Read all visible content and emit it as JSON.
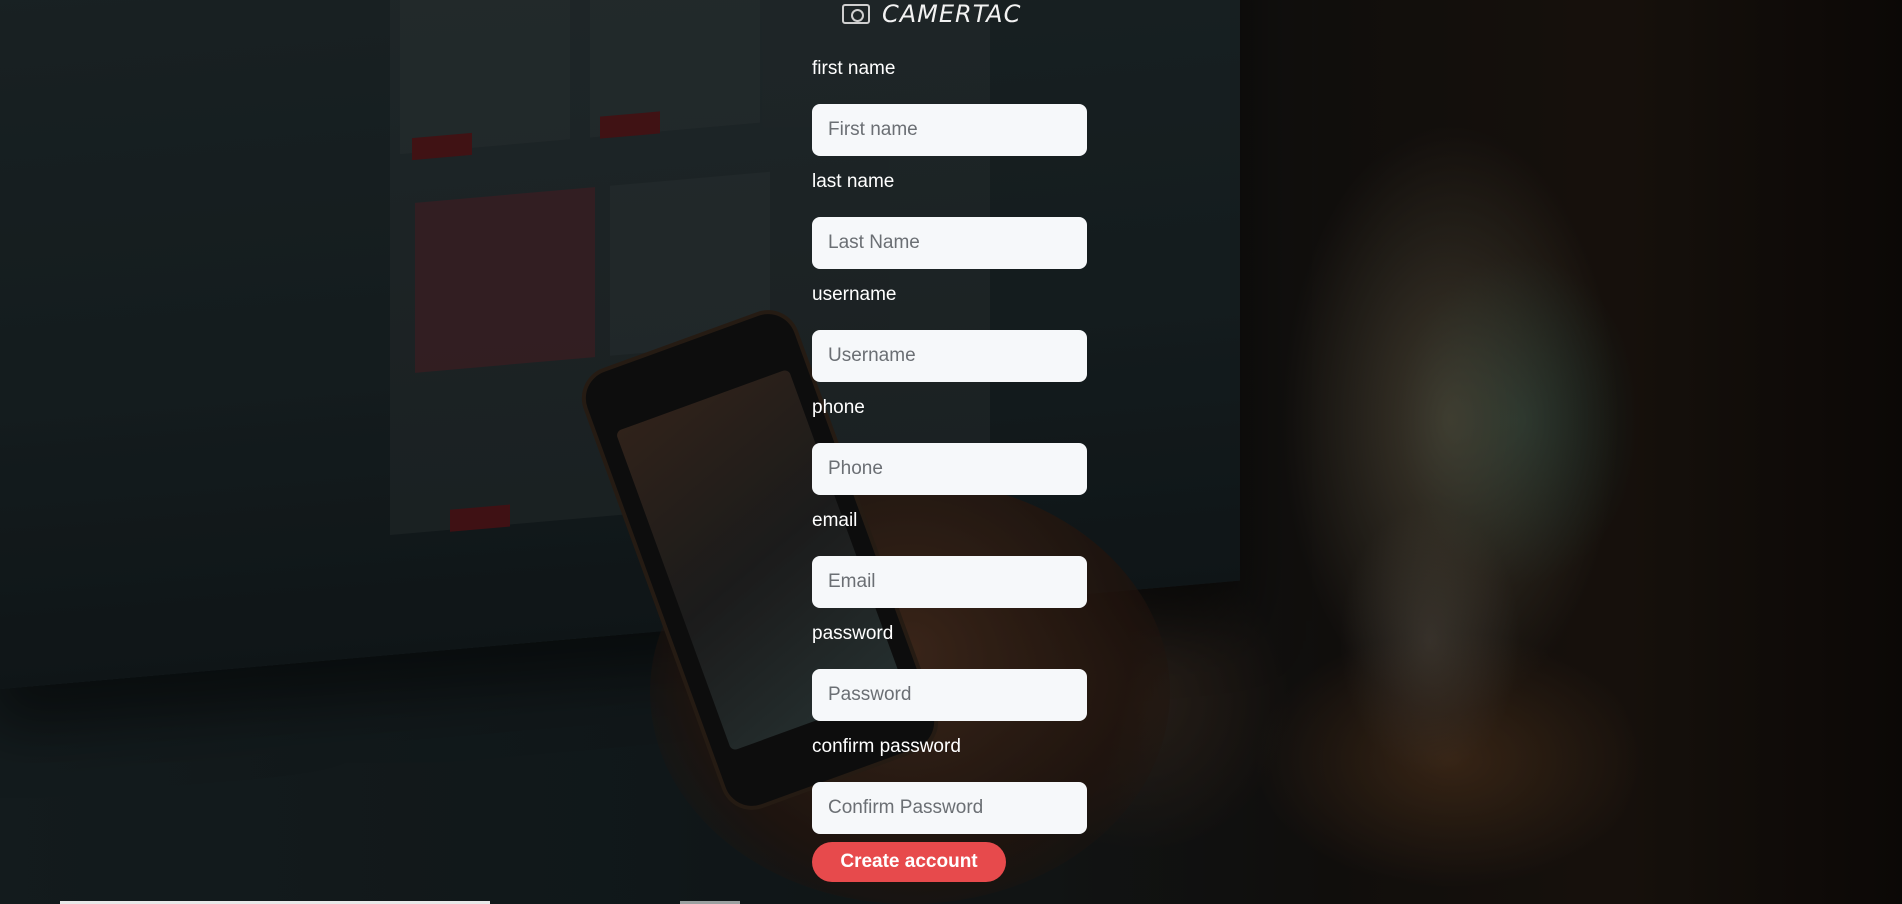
{
  "brand": {
    "logo_text": "CAMERTAC",
    "icon": "camera-icon"
  },
  "form": {
    "fields": [
      {
        "label": "first name",
        "placeholder": "First name"
      },
      {
        "label": "last name",
        "placeholder": "Last Name"
      },
      {
        "label": "username",
        "placeholder": "Username"
      },
      {
        "label": "phone",
        "placeholder": "Phone"
      },
      {
        "label": "email",
        "placeholder": "Email"
      },
      {
        "label": "password",
        "placeholder": "Password"
      },
      {
        "label": "confirm password",
        "placeholder": "Confirm Password"
      }
    ],
    "submit_label": "Create account"
  },
  "colors": {
    "accent": "#e74a4c",
    "input_bg": "#f6f8fa",
    "label_text": "#ffffff"
  }
}
